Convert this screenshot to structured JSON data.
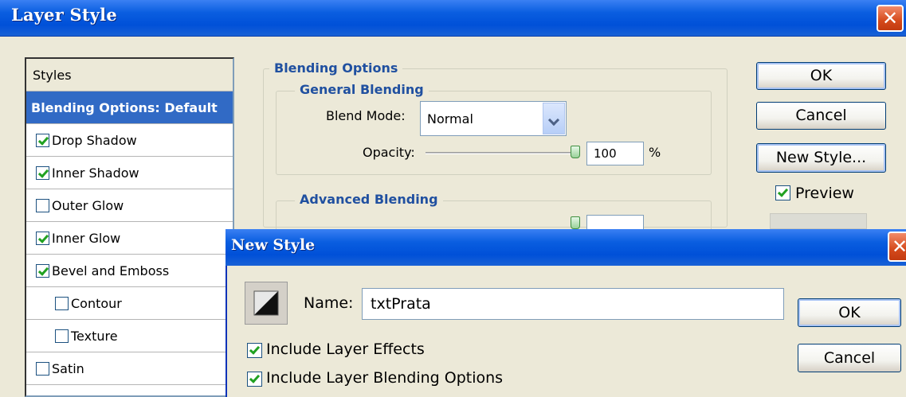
{
  "window": {
    "title": "Layer Style",
    "close_glyph": "✕"
  },
  "styles_panel": {
    "header": "Styles",
    "items": [
      {
        "label": "Blending Options: Default",
        "checkbox": null,
        "selected": true
      },
      {
        "label": "Drop Shadow",
        "checked": true
      },
      {
        "label": "Inner Shadow",
        "checked": true
      },
      {
        "label": "Outer Glow",
        "checked": false
      },
      {
        "label": "Inner Glow",
        "checked": true
      },
      {
        "label": "Bevel and Emboss",
        "checked": true
      },
      {
        "label": "Contour",
        "checked": false,
        "indent": true
      },
      {
        "label": "Texture",
        "checked": false,
        "indent": true
      },
      {
        "label": "Satin",
        "checked": false
      }
    ]
  },
  "blending": {
    "section_title": "Blending Options",
    "general_title": "General Blending",
    "blend_mode_label": "Blend Mode:",
    "blend_mode_value": "Normal",
    "opacity_label": "Opacity:",
    "opacity_value": "100",
    "opacity_unit": "%",
    "advanced_title": "Advanced Blending"
  },
  "buttons": {
    "ok": "OK",
    "cancel": "Cancel",
    "new_style": "New Style...",
    "preview_label": "Preview",
    "preview_checked": true
  },
  "new_style_dialog": {
    "title": "New Style",
    "close_glyph": "✕",
    "name_label": "Name:",
    "name_value": "txtPrata",
    "include_effects_label": "Include Layer Effects",
    "include_effects_checked": true,
    "include_blending_label": "Include Layer Blending Options",
    "include_blending_checked": true,
    "ok": "OK",
    "cancel": "Cancel"
  },
  "colors": {
    "titlebar": "#0050d8",
    "selection": "#316ac5",
    "dialog_bg": "#ece9d8",
    "group_label": "#2050a0"
  }
}
